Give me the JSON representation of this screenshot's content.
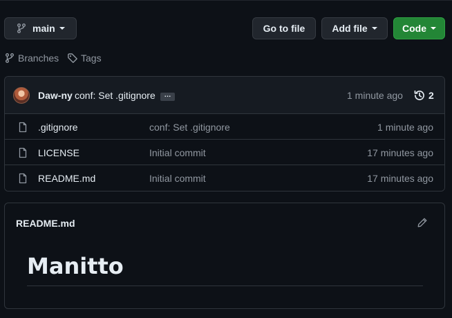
{
  "toolbar": {
    "branch_label": "main",
    "go_to_file_label": "Go to file",
    "add_file_label": "Add file",
    "code_label": "Code"
  },
  "repo_meta": {
    "branches_label": "Branches",
    "tags_label": "Tags"
  },
  "latest_commit": {
    "author": "Daw-ny",
    "message": "conf: Set .gitignore",
    "ellipsis": "…",
    "time": "1 minute ago",
    "commit_count": "2"
  },
  "files": [
    {
      "name": ".gitignore",
      "commit": "conf: Set .gitignore",
      "time": "1 minute ago"
    },
    {
      "name": "LICENSE",
      "commit": "Initial commit",
      "time": "17 minutes ago"
    },
    {
      "name": "README.md",
      "commit": "Initial commit",
      "time": "17 minutes ago"
    }
  ],
  "readme": {
    "title": "README.md",
    "heading": "Manitto"
  },
  "colors": {
    "background": "#0d1117",
    "panel": "#161b22",
    "border": "#30363d",
    "primary_button": "#238636",
    "muted_text": "#9198a1",
    "text": "#e6edf3"
  },
  "icons": {
    "branch": "git-branch-icon",
    "tag": "tag-icon",
    "history": "history-icon",
    "file": "file-icon",
    "edit": "pencil-icon"
  }
}
